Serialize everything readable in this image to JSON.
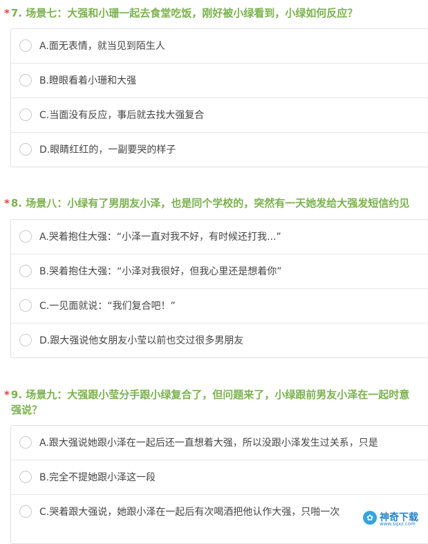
{
  "questions": [
    {
      "star": "*",
      "title": "7. 场景七：大强和小珊一起去食堂吃饭，刚好被小绿看到，小绿如何反应？",
      "title_cont": "",
      "options": [
        "A.面无表情，就当见到陌生人",
        "B.瞪眼看着小珊和大强",
        "C.当面没有反应，事后就去找大强复合",
        "D.眼睛红红的，一副要哭的样子"
      ]
    },
    {
      "star": "*",
      "title": "8. 场景八：小绿有了男朋友小泽，也是同个学校的，突然有一天她发给大强发短信约见",
      "title_cont": "",
      "options": [
        "A.哭着抱住大强：“小泽一直对我不好，有时候还打我...”",
        "B.哭着抱住大强：“小泽对我很好，但我心里还是想着你”",
        "C.一见面就说：“我们复合吧！”",
        "D.跟大强说他女朋友小莹以前也交过很多男朋友"
      ]
    },
    {
      "star": "*",
      "title": "9. 场景九：大强跟小莹分手跟小绿复合了，但问题来了，小绿跟前男友小泽在一起时意",
      "title_cont": "强说？",
      "options": [
        "A.跟大强说她跟小泽在一起后还一直想着大强，所以没跟小泽发生过关系，只是",
        "B.完全不提她跟小泽这一段",
        "C.哭着跟大强说，她跟小泽在一起后有次喝酒把他认作大强，只啪一次"
      ]
    }
  ],
  "watermark": {
    "icon": "gear-flower-icon",
    "text": "神奇下载",
    "sub": "www.sqxz.com"
  }
}
